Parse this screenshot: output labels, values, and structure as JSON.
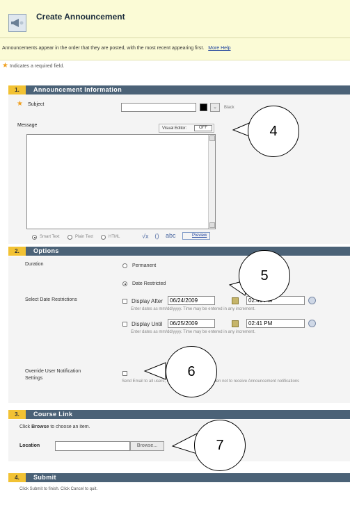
{
  "header": {
    "title": "Create Announcement",
    "intro": "Announcements appear in the order that they are posted, with the most recent appearing first.",
    "more_help": "More Help",
    "required_note": "Indicates a required field."
  },
  "sections": {
    "s1": {
      "num": "1.",
      "title": "Announcement Information"
    },
    "s2": {
      "num": "2.",
      "title": "Options"
    },
    "s3": {
      "num": "3.",
      "title": "Course Link"
    },
    "s4": {
      "num": "4.",
      "title": "Submit"
    }
  },
  "announcement": {
    "subject_label": "Subject",
    "subject_value": "",
    "color_label": "Black",
    "message_label": "Message",
    "visual_editor_label": "Visual Editor:",
    "visual_editor_state": "OFF",
    "text_modes": [
      "Smart Text",
      "Plain Text",
      "HTML"
    ],
    "preview_label": "Preview",
    "sqrt_glyph": "√x",
    "link_glyph": "⟨⟩",
    "spell_glyph": "abc"
  },
  "options": {
    "duration_label": "Duration",
    "permanent_label": "Permanent",
    "date_restricted_label": "Date Restricted",
    "select_dates_label": "Select Date Restrictions",
    "display_after_label": "Display After",
    "display_after_date": "06/24/2009",
    "display_after_time": "02:41 PM",
    "display_until_label": "Display Until",
    "display_until_date": "06/25/2009",
    "display_until_time": "02:41 PM",
    "date_hint": "Enter dates as mm/dd/yyyy. Time may be entered in any increment.",
    "override_label_1": "Override User Notification",
    "override_label_2": "Settings",
    "override_hint": "Send Email to all users, even those who have chosen not to receive Announcement notifications"
  },
  "course_link": {
    "instruction_prefix": "Click ",
    "instruction_bold": "Browse",
    "instruction_suffix": " to choose an item.",
    "location_label": "Location",
    "location_value": "",
    "browse_label": "Browse..."
  },
  "submit": {
    "instruction": "Click Submit to finish. Click Cancel to quit."
  },
  "callouts": {
    "c4": "4",
    "c5": "5",
    "c6": "6",
    "c7": "7"
  },
  "colors": {
    "header_bg": "#fbfbd6",
    "section_bar": "#4b6277",
    "section_num": "#f2c233",
    "required_star": "#f0a020",
    "link": "#1a3f9c"
  }
}
